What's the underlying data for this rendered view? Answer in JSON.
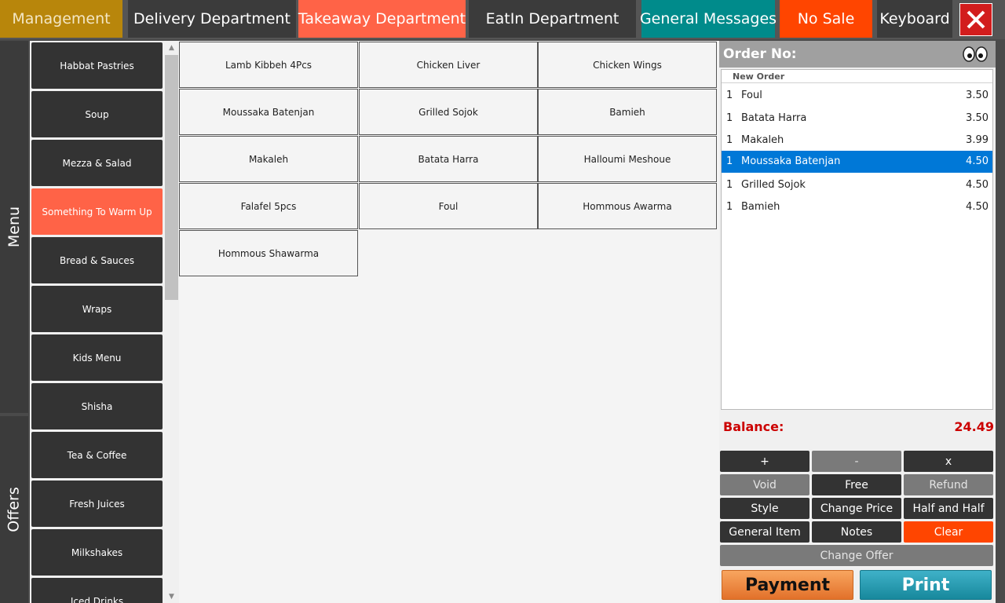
{
  "top_nav": {
    "management": "Management",
    "delivery": "Delivery Department",
    "takeaway": "Takeaway Department",
    "eatin": "EatIn Department",
    "general_messages": "General Messages",
    "no_sale": "No Sale",
    "keyboard": "Keyboard"
  },
  "side_tabs": {
    "menu": "Menu",
    "offers": "Offers"
  },
  "categories": [
    "Habbat Pastries",
    "Soup",
    "Mezza & Salad",
    "Something To Warm Up",
    "Bread & Sauces",
    "Wraps",
    "Kids Menu",
    "Shisha",
    "Tea & Coffee",
    "Fresh Juices",
    "Milkshakes",
    "Iced Drinks"
  ],
  "active_category": "Something To Warm Up",
  "items": [
    "Lamb Kibbeh 4Pcs",
    "Chicken Liver",
    "Chicken Wings",
    "Moussaka Batenjan",
    "Grilled Sojok",
    "Bamieh",
    "Makaleh",
    "Batata Harra",
    "Halloumi Meshoue",
    "Falafel 5pcs",
    "Foul",
    "Hommous Awarma",
    "Hommous Shawarma"
  ],
  "order": {
    "title": "Order No:",
    "list_heading": "New Order",
    "lines": [
      {
        "qty": "1",
        "name": "Foul",
        "price": "3.50"
      },
      {
        "qty": "1",
        "name": "Batata Harra",
        "price": "3.50"
      },
      {
        "qty": "1",
        "name": "Makaleh",
        "price": "3.99"
      },
      {
        "qty": "1",
        "name": "Moussaka Batenjan",
        "price": "4.50"
      },
      {
        "qty": "1",
        "name": "Grilled Sojok",
        "price": "4.50"
      },
      {
        "qty": "1",
        "name": "Bamieh",
        "price": "4.50"
      }
    ],
    "selected_index": 3,
    "balance_label": "Balance:",
    "balance_value": "24.49"
  },
  "actions": {
    "plus": "+",
    "minus": "-",
    "remove": "x",
    "void": "Void",
    "free": "Free",
    "refund": "Refund",
    "style": "Style",
    "change_price": "Change Price",
    "half_and_half": "Half and Half",
    "general_item": "General Item",
    "notes": "Notes",
    "clear": "Clear",
    "change_offer": "Change Offer",
    "payment": "Payment",
    "print": "Print"
  },
  "colors": {
    "accent_active": "#ff6347",
    "management": "#b8860b",
    "teal": "#008b8b",
    "orange": "#ff4500",
    "selected_row": "#0078d7",
    "balance": "#cc0000"
  }
}
